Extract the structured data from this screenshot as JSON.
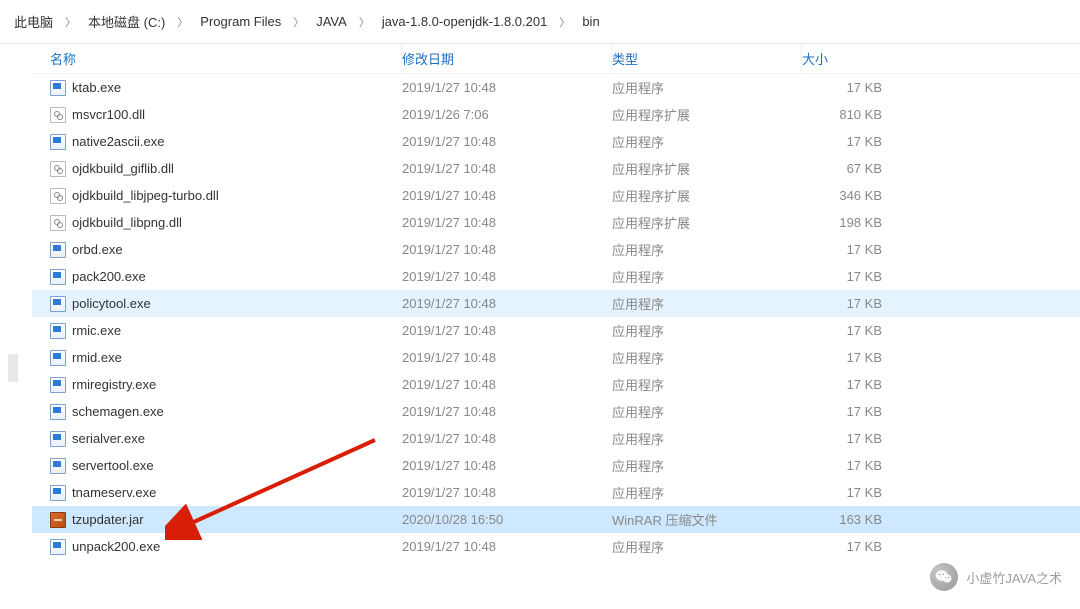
{
  "breadcrumb": [
    "此电脑",
    "本地磁盘 (C:)",
    "Program Files",
    "JAVA",
    "java-1.8.0-openjdk-1.8.0.201",
    "bin"
  ],
  "headers": {
    "name": "名称",
    "date": "修改日期",
    "type": "类型",
    "size": "大小"
  },
  "files": [
    {
      "name": "ktab.exe",
      "date": "2019/1/27 10:48",
      "type": "应用程序",
      "size": "17 KB",
      "icon": "exe"
    },
    {
      "name": "msvcr100.dll",
      "date": "2019/1/26 7:06",
      "type": "应用程序扩展",
      "size": "810 KB",
      "icon": "dll"
    },
    {
      "name": "native2ascii.exe",
      "date": "2019/1/27 10:48",
      "type": "应用程序",
      "size": "17 KB",
      "icon": "exe"
    },
    {
      "name": "ojdkbuild_giflib.dll",
      "date": "2019/1/27 10:48",
      "type": "应用程序扩展",
      "size": "67 KB",
      "icon": "dll"
    },
    {
      "name": "ojdkbuild_libjpeg-turbo.dll",
      "date": "2019/1/27 10:48",
      "type": "应用程序扩展",
      "size": "346 KB",
      "icon": "dll"
    },
    {
      "name": "ojdkbuild_libpng.dll",
      "date": "2019/1/27 10:48",
      "type": "应用程序扩展",
      "size": "198 KB",
      "icon": "dll"
    },
    {
      "name": "orbd.exe",
      "date": "2019/1/27 10:48",
      "type": "应用程序",
      "size": "17 KB",
      "icon": "exe"
    },
    {
      "name": "pack200.exe",
      "date": "2019/1/27 10:48",
      "type": "应用程序",
      "size": "17 KB",
      "icon": "exe"
    },
    {
      "name": "policytool.exe",
      "date": "2019/1/27 10:48",
      "type": "应用程序",
      "size": "17 KB",
      "icon": "exe",
      "highlight": true
    },
    {
      "name": "rmic.exe",
      "date": "2019/1/27 10:48",
      "type": "应用程序",
      "size": "17 KB",
      "icon": "exe"
    },
    {
      "name": "rmid.exe",
      "date": "2019/1/27 10:48",
      "type": "应用程序",
      "size": "17 KB",
      "icon": "exe"
    },
    {
      "name": "rmiregistry.exe",
      "date": "2019/1/27 10:48",
      "type": "应用程序",
      "size": "17 KB",
      "icon": "exe"
    },
    {
      "name": "schemagen.exe",
      "date": "2019/1/27 10:48",
      "type": "应用程序",
      "size": "17 KB",
      "icon": "exe"
    },
    {
      "name": "serialver.exe",
      "date": "2019/1/27 10:48",
      "type": "应用程序",
      "size": "17 KB",
      "icon": "exe"
    },
    {
      "name": "servertool.exe",
      "date": "2019/1/27 10:48",
      "type": "应用程序",
      "size": "17 KB",
      "icon": "exe"
    },
    {
      "name": "tnameserv.exe",
      "date": "2019/1/27 10:48",
      "type": "应用程序",
      "size": "17 KB",
      "icon": "exe"
    },
    {
      "name": "tzupdater.jar",
      "date": "2020/10/28 16:50",
      "type": "WinRAR 压缩文件",
      "size": "163 KB",
      "icon": "jar",
      "selected": true
    },
    {
      "name": "unpack200.exe",
      "date": "2019/1/27 10:48",
      "type": "应用程序",
      "size": "17 KB",
      "icon": "exe"
    }
  ],
  "watermark": {
    "text": "小虚竹JAVA之术"
  }
}
